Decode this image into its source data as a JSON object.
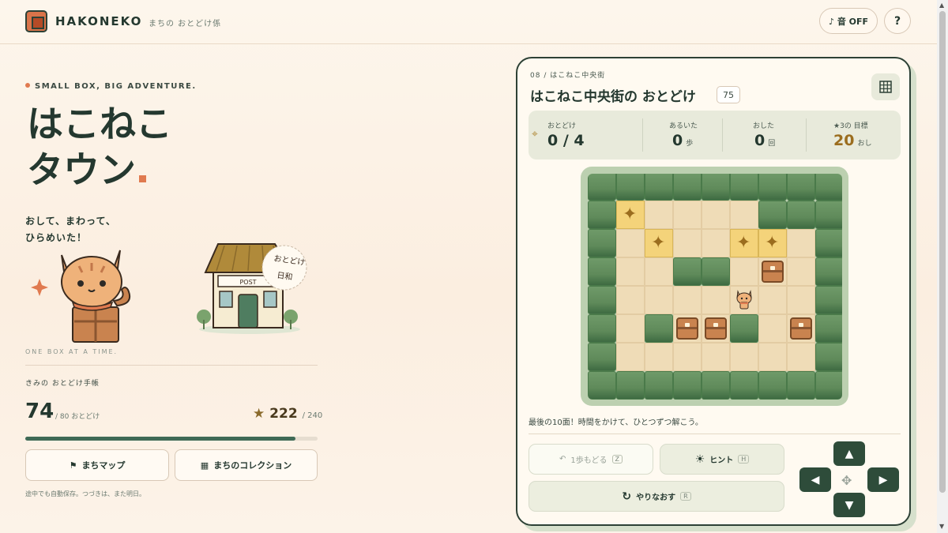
{
  "header": {
    "brand": "HAKONEKO",
    "subtitle": "まちの おとどけ係",
    "sound_label": "♪ 音 OFF",
    "help_label": "?"
  },
  "hero": {
    "tagline": "SMALL BOX, BIG ADVENTURE.",
    "title_line1": "はこねこ",
    "title_line2": "タウン",
    "subtitle_line1": "おして、まわって、",
    "subtitle_line2": "ひらめいた！",
    "house_sign": "POST",
    "stamp_line1": "おとどけ",
    "stamp_line2": "日和",
    "caption": "ONE BOX AT A TIME."
  },
  "progress": {
    "label": "きみの おとどけ手帳",
    "delivered": "74",
    "delivered_total": "/ 80 おとどけ",
    "delivered_fraction": 0.925,
    "stars": "222",
    "stars_total": "/ 240",
    "map_button": "まちマップ",
    "collection_button": "まちのコレクション",
    "save_note": "途中でも自動保存。つづきは、また明日。"
  },
  "level": {
    "breadcrumb": "08 / はこねこ中央街",
    "title": "はこねこ中央街の おとどけ",
    "badge": "75",
    "stats": {
      "delivered_label": "おとどけ",
      "delivered_value": "0 / 4",
      "steps_label": "あるいた",
      "steps_value": "0",
      "steps_unit": "歩",
      "pushes_label": "おした",
      "pushes_value": "0",
      "pushes_unit": "回",
      "goal_label": "★3の 目標",
      "goal_value": "20",
      "goal_unit": "おし"
    },
    "hint_text": "最後の10面！時間をかけて、ひとつずつ解こう。",
    "undo_label": "1歩もどる",
    "undo_key": "Z",
    "hint_label": "ヒント",
    "hint_key": "H",
    "reset_label": "やりなおす",
    "reset_key": "R"
  },
  "board": {
    "cols": 9,
    "rows": 8,
    "map": [
      "WWWWWWWWW",
      "WG....WWW",
      "W.G..GG.W",
      "W..WW.B.W",
      "W....P..W",
      "W.WBBW.BW",
      "W.......W",
      "WWWWWWWWW"
    ]
  },
  "colors": {
    "accent": "#e07a4f",
    "dark_green": "#2e4c3a",
    "gold": "#9b6d1e"
  }
}
